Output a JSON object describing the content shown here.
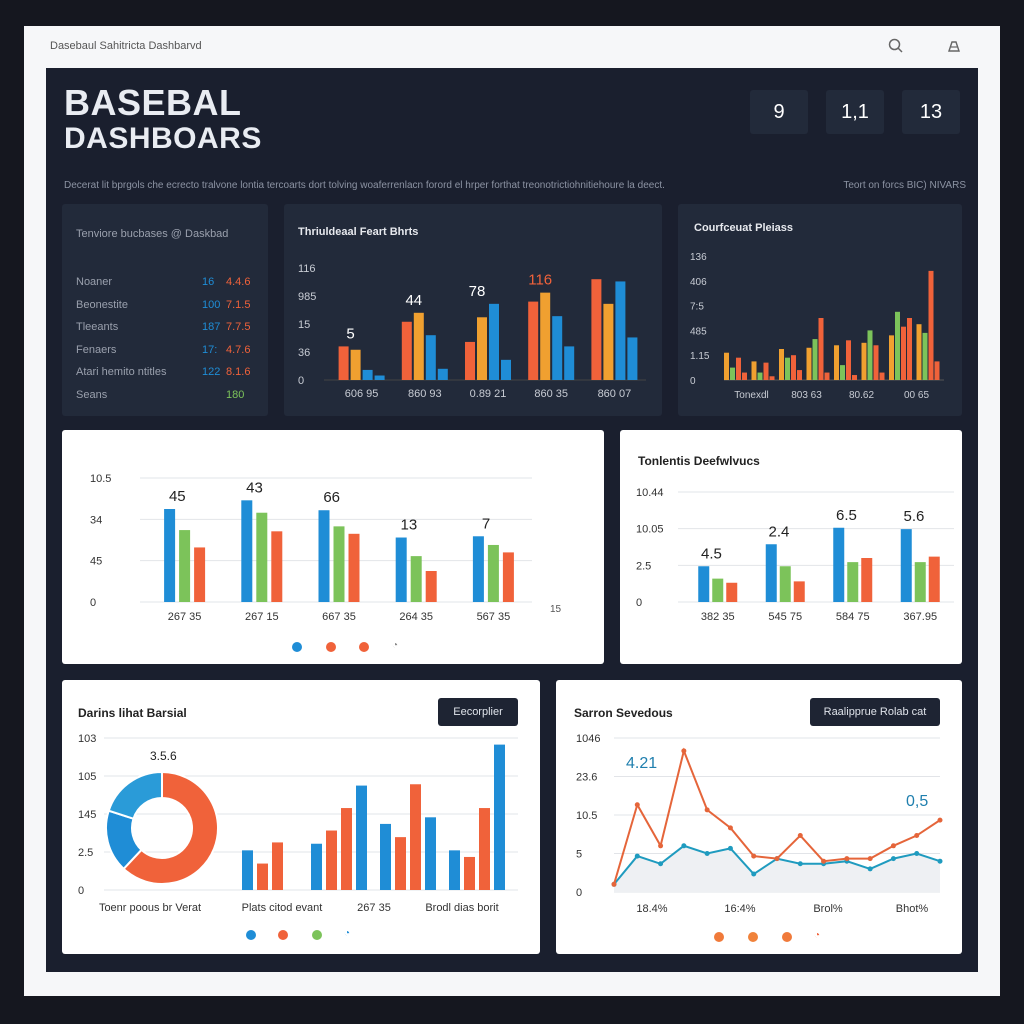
{
  "window": {
    "title": "Dasebaul Sahitricta Dashbarvd",
    "search_icon": "search-icon",
    "user_icon": "user-icon"
  },
  "header": {
    "title_line1": "BASEBAL",
    "title_line2": "DASHBOARS",
    "stats": [
      "9",
      "1,1",
      "13"
    ],
    "description": "Decerat lit bprgols che ecrecto tralvone lontia tercoarts dort tolving woaferrenlacn forord el hrper forthat treonotrictiohnitiehoure la deect.",
    "right_note": "Teort on forcs BIC) NIVARS"
  },
  "panel_stats": {
    "title": "Tenviore bucbases @ Daskbad",
    "rows": [
      {
        "label": "Noaner",
        "v1": "16",
        "v2": "4.4.6"
      },
      {
        "label": "Beonestite",
        "v1": "100",
        "v2": "7.1.5"
      },
      {
        "label": "Tleeants",
        "v1": "187",
        "v2": "7.7.5"
      },
      {
        "label": "Fenaers",
        "v1": "17:",
        "v2": "4.7.6"
      },
      {
        "label": "Atari hemito ntitles",
        "v1": "122",
        "v2": "8.1.6"
      },
      {
        "label": "Seans",
        "v1": "",
        "v2": "180"
      }
    ]
  },
  "colors": {
    "blue": "#1f8dd6",
    "orange": "#f0623a",
    "green": "#7cc35a",
    "amber": "#f0a030",
    "dark": "#1a1f2e"
  },
  "chart_data": [
    {
      "type": "bar",
      "title": "Thriuldeaal Feart Bhrts",
      "yticks": [
        "116",
        "985",
        "15",
        "36",
        "0"
      ],
      "categories": [
        "606 95",
        "860 93",
        "0.89 21",
        "860 35",
        "860 07"
      ],
      "annotations": [
        "5",
        "44",
        "78",
        "116"
      ],
      "series": [
        {
          "values": [
            30,
            52,
            34,
            70,
            90
          ]
        },
        {
          "values": [
            27,
            60,
            56,
            78,
            68
          ]
        },
        {
          "values": [
            9,
            40,
            68,
            57,
            88
          ]
        },
        {
          "values": [
            4,
            10,
            18,
            30,
            38
          ]
        }
      ]
    },
    {
      "type": "bar",
      "title": "Courfceuat Pleiass",
      "yticks": [
        "136",
        "406",
        "7:5",
        "485",
        "1.15",
        "0"
      ],
      "categories": [
        "Tonexdl",
        "803 63",
        "80.62",
        "00 65"
      ],
      "series": [
        {
          "values": [
            22,
            15,
            25,
            26,
            28,
            30,
            36,
            45
          ]
        },
        {
          "values": [
            10,
            6,
            18,
            33,
            12,
            40,
            55,
            38
          ]
        },
        {
          "values": [
            18,
            14,
            20,
            50,
            32,
            28,
            43,
            88
          ]
        },
        {
          "values": [
            6,
            3,
            8,
            6,
            4,
            6,
            50,
            15
          ]
        }
      ]
    },
    {
      "type": "bar",
      "yticks": [
        "10.5",
        "34",
        "45",
        "0"
      ],
      "categories": [
        "267 35",
        "267 15",
        "667 35",
        "264 35",
        "567 35"
      ],
      "annotations": [
        "45",
        "43",
        "66",
        "13",
        "7"
      ],
      "right_tick": "15",
      "series": [
        {
          "values": [
            7.5,
            8.2,
            7.4,
            5.2,
            5.3
          ]
        },
        {
          "values": [
            5.8,
            7.2,
            6.1,
            3.7,
            4.6
          ]
        },
        {
          "values": [
            4.4,
            5.7,
            5.5,
            2.5,
            4.0
          ]
        }
      ]
    },
    {
      "type": "bar",
      "title": "Tonlentis Deefwlvucs",
      "yticks": [
        "10.44",
        "10.05",
        "2.5",
        "0"
      ],
      "categories": [
        "382 35",
        "545 75",
        "584 75",
        "367.95"
      ],
      "annotations": [
        "4.5",
        "2.4",
        "6.5",
        "5.6"
      ],
      "series": [
        {
          "values": [
            2.6,
            4.2,
            5.4,
            5.3
          ]
        },
        {
          "values": [
            1.7,
            2.6,
            2.9,
            2.9
          ]
        },
        {
          "values": [
            1.4,
            1.5,
            3.2,
            3.3
          ]
        }
      ]
    },
    {
      "type": "bar",
      "title": "Darins lihat Barsial",
      "yticks": [
        "103",
        "105",
        "145",
        "2.5",
        "0"
      ],
      "categories": [
        "Toenr poous br Verat",
        "Plats citod evant",
        "267 35",
        "Brodl dias borit"
      ],
      "donut_label": "3.5.6",
      "donut": [
        {
          "value": 62,
          "color": "orange"
        },
        {
          "value": 18,
          "color": "blue"
        },
        {
          "value": 20,
          "color": "blue2"
        }
      ],
      "series": [
        {
          "values": [
            30,
            35,
            50,
            30
          ]
        },
        {
          "values": [
            20,
            45,
            40,
            25
          ]
        },
        {
          "values": [
            36,
            62,
            80,
            62
          ]
        },
        {
          "values": [
            0,
            79,
            55,
            110
          ]
        }
      ]
    },
    {
      "type": "line",
      "title": "Sarron Sevedous",
      "yticks": [
        "1046",
        "23.6",
        "10.5",
        "5",
        "0"
      ],
      "categories": [
        "18.4%",
        "16:4%",
        "Brol%",
        "Bhot%"
      ],
      "annotations": [
        "4.21",
        "0,5"
      ],
      "series": [
        {
          "name": "orange",
          "values": [
            0.3,
            3.4,
            1.8,
            5.5,
            3.2,
            2.5,
            1.4,
            1.3,
            2.2,
            1.2,
            1.3,
            1.3,
            1.8,
            2.2,
            2.8
          ]
        },
        {
          "name": "teal",
          "values": [
            0.3,
            1.4,
            1.1,
            1.8,
            1.5,
            1.7,
            0.7,
            1.3,
            1.1,
            1.1,
            1.2,
            0.9,
            1.3,
            1.5,
            1.2
          ]
        }
      ]
    }
  ],
  "cards": {
    "card1_btn": "",
    "card3_btn": "Eecorplier",
    "card4_btn": "Raalipprue Rolab cat"
  }
}
